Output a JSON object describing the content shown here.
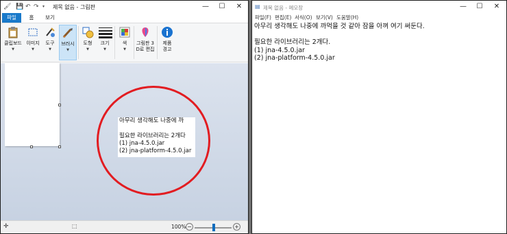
{
  "paint": {
    "title": "제목 없음 - 그림판",
    "tabs": [
      "파일",
      "홈",
      "보기"
    ],
    "ribbon": {
      "clipboard": "클립보드",
      "image": "이미지",
      "tools": "도구",
      "brush": "브러시",
      "shapes": "도형",
      "size": "크기",
      "color": "색",
      "paint3d_line1": "그림판 3",
      "paint3d_line2": "D로 편집",
      "product_line1": "제품",
      "product_line2": "경고"
    },
    "pasted_lines": [
      "아무리 생각해도 나중에 까",
      "",
      "필요한 라이브러리는 2개다",
      "(1) jna-4.5.0.jar",
      "(2) jna-platform-4.5.0.jar"
    ],
    "status": {
      "zoom": "100%"
    },
    "annotation_color": "#e21c21"
  },
  "notepad": {
    "title": "제목 없음 - 메모장",
    "menu": [
      "파일(F)",
      "편집(E)",
      "서식(O)",
      "보기(V)",
      "도움말(H)"
    ],
    "lines": [
      "아무리 생각해도 나중에 까먹을 것 같아 잠을 아껴 여기 써둔다.",
      "",
      "필요한 라이브러리는 2개다.",
      "(1) jna-4.5.0.jar",
      "(2) jna-platform-4.5.0.jar"
    ]
  }
}
